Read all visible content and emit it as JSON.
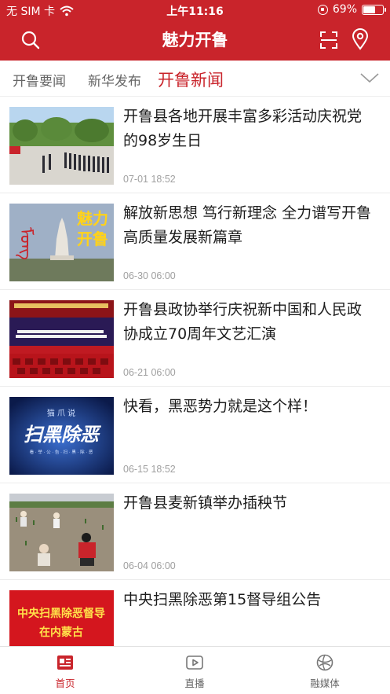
{
  "status_bar": {
    "carrier": "无 SIM 卡",
    "time": "上午11:16",
    "battery_percent": "69%",
    "battery_level": 0.69
  },
  "header": {
    "title": "魅力开鲁",
    "bg_color": "#c9242b",
    "left_icon": "search-icon",
    "right_icons": [
      "scan-icon",
      "location-icon"
    ]
  },
  "tabs": [
    {
      "label": "开鲁要闻",
      "active": false
    },
    {
      "label": "新华发布",
      "active": false
    },
    {
      "label": "开鲁新闻",
      "active": true
    }
  ],
  "news": [
    {
      "title": "开鲁县各地开展丰富多彩活动庆祝党的98岁生日",
      "date": "07-01 18:52"
    },
    {
      "title": "解放新思想 笃行新理念 全力谱写开鲁高质量发展新篇章",
      "date": "06-30 06:00",
      "thumb_text": [
        "魅力",
        "开鲁"
      ]
    },
    {
      "title": "开鲁县政协举行庆祝新中国和人民政协成立70周年文艺汇演",
      "date": "06-21 06:00"
    },
    {
      "title": "快看，黑恶势力就是这个样！",
      "date": "06-15 18:52",
      "thumb_text": [
        "猫 爪 说",
        "扫黑除恶",
        "看 · 举 · 公 · 告 · 扫 · 黑 · 除 · 恶"
      ]
    },
    {
      "title": "开鲁县麦新镇举办插秧节",
      "date": "06-04 06:00"
    },
    {
      "title": "中央扫黑除恶第15督导组公告",
      "date": "",
      "thumb_text": [
        "中央扫黑除恶督导",
        "在内蒙古"
      ]
    }
  ],
  "bottom_nav": [
    {
      "label": "首页",
      "icon": "news-icon",
      "active": true
    },
    {
      "label": "直播",
      "icon": "play-icon",
      "active": false
    },
    {
      "label": "融媒体",
      "icon": "globe-icon",
      "active": false
    }
  ]
}
